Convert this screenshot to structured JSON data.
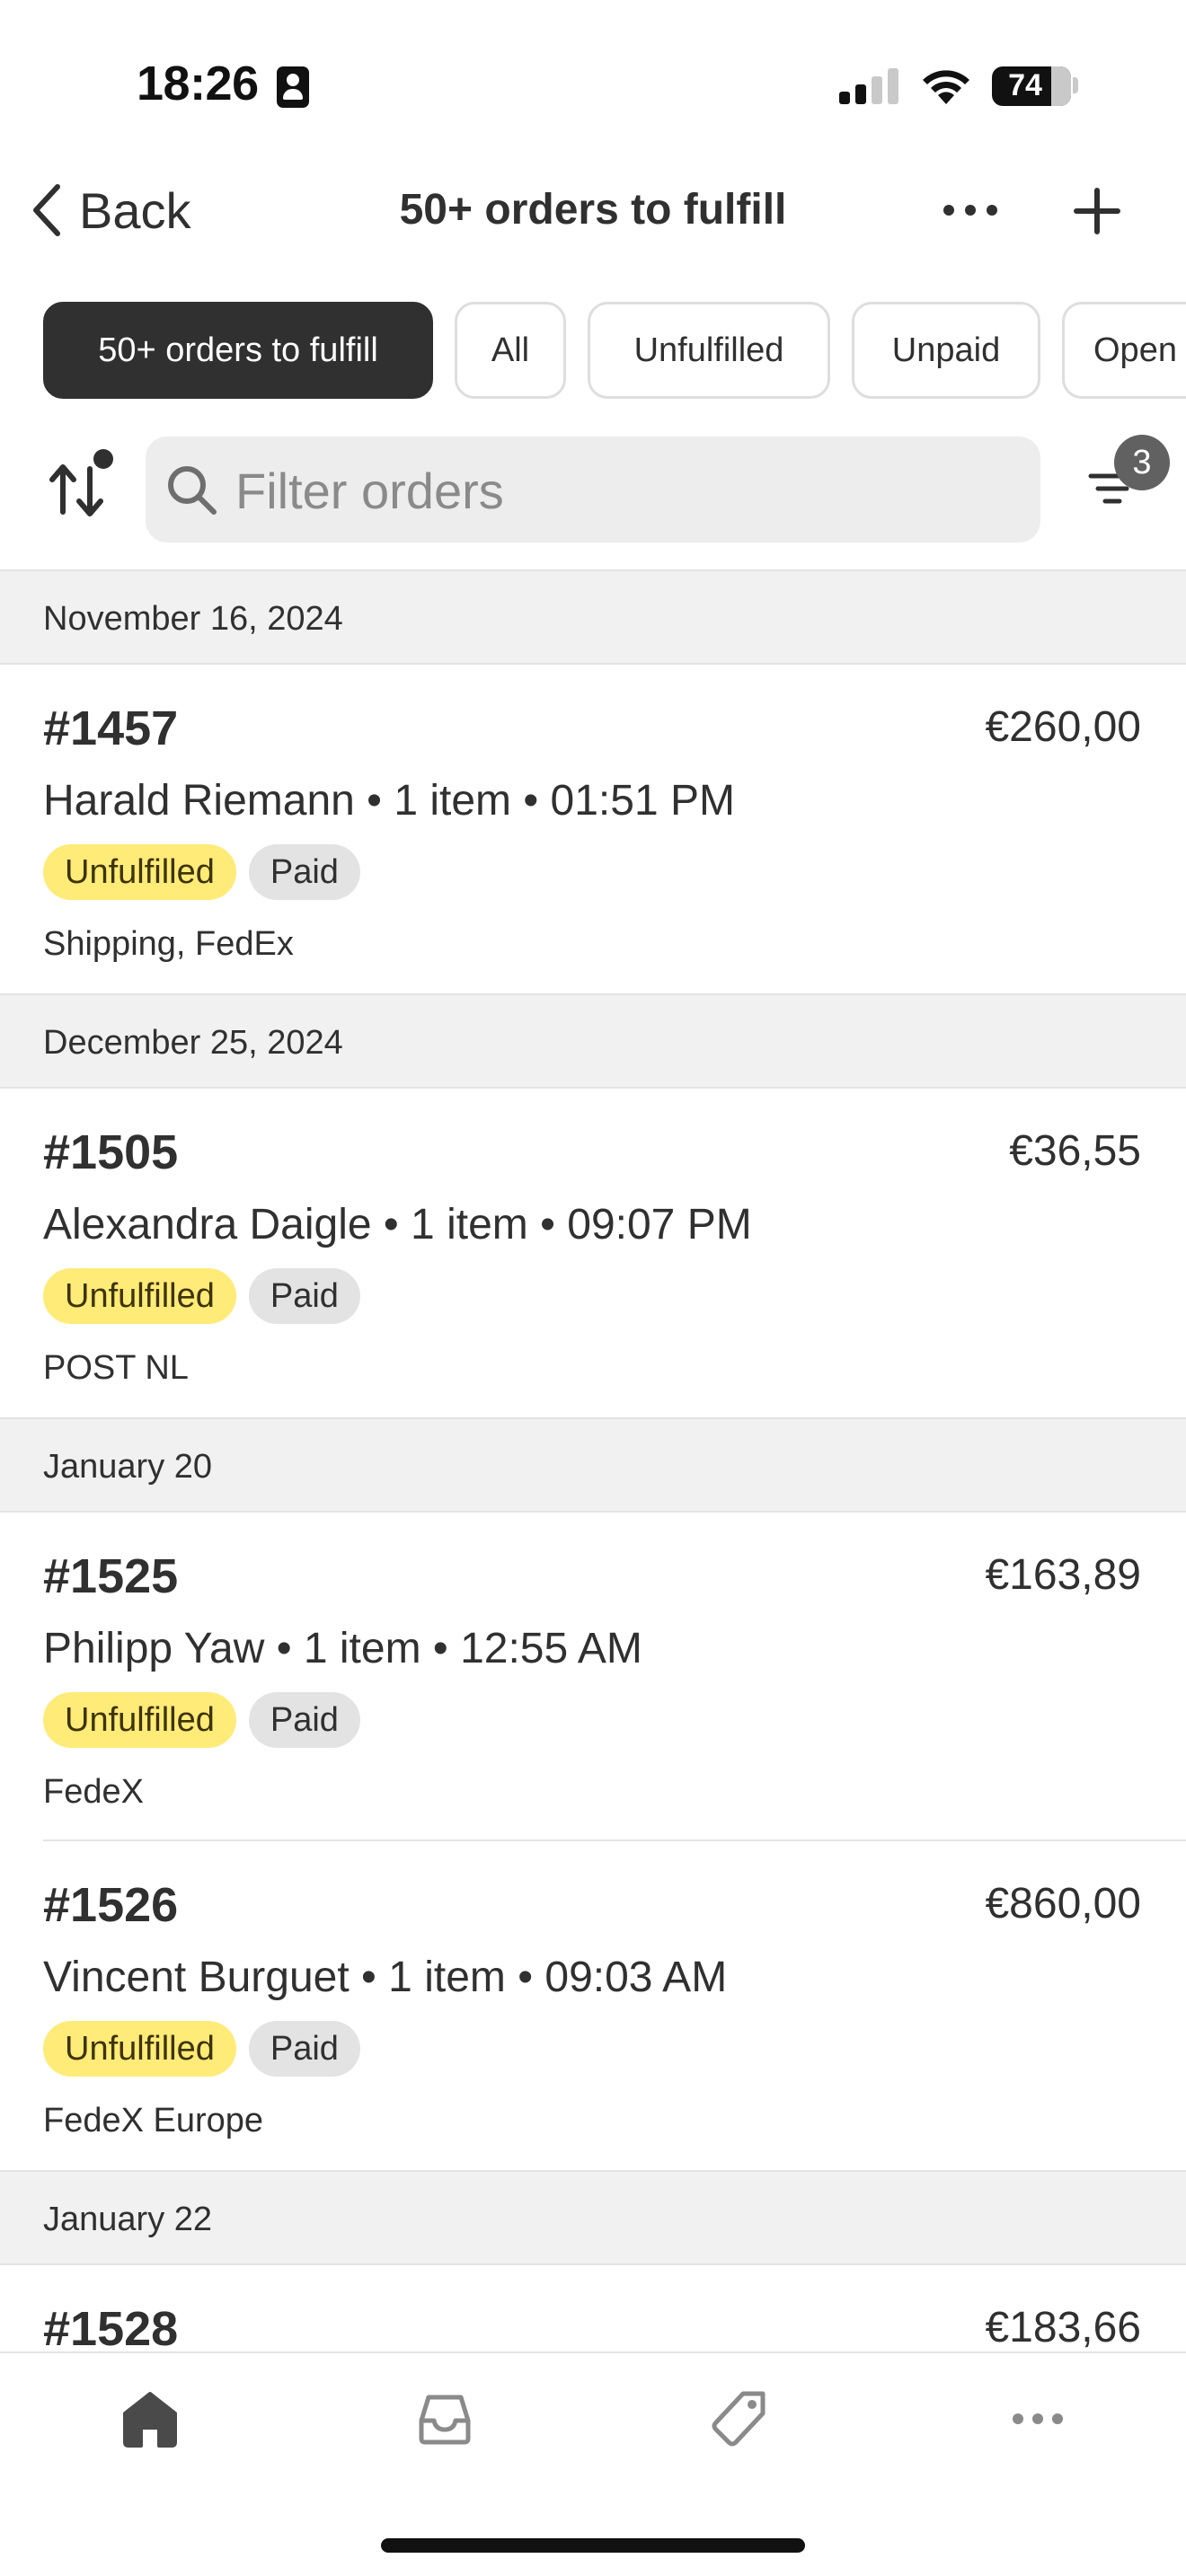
{
  "status_bar": {
    "time": "18:26",
    "battery": "74",
    "icons": [
      "person-badge-icon",
      "signal-icon",
      "wifi-icon",
      "battery-icon"
    ]
  },
  "navbar": {
    "back_label": "Back",
    "title": "50+ orders to fulfill",
    "icons": [
      "chevron-left-icon",
      "more-icon",
      "plus-icon"
    ]
  },
  "chips": [
    {
      "label": "50+ orders to fulfill",
      "active": true
    },
    {
      "label": "All",
      "active": false
    },
    {
      "label": "Unfulfilled",
      "active": false
    },
    {
      "label": "Unpaid",
      "active": false
    },
    {
      "label": "Open",
      "active": false
    }
  ],
  "search": {
    "placeholder": "Filter orders",
    "filter_count": "3",
    "icons": [
      "sort-icon",
      "search-icon",
      "filter-icon"
    ]
  },
  "sections": [
    {
      "date": "November 16, 2024",
      "orders": [
        {
          "number": "#1457",
          "price": "€260,00",
          "customer": "Harald Riemann",
          "items": "1 item",
          "time": "01:51 PM",
          "badges": [
            "Unfulfilled",
            "Paid"
          ],
          "shipping": "Shipping, FedEx"
        }
      ]
    },
    {
      "date": "December 25, 2024",
      "orders": [
        {
          "number": "#1505",
          "price": "€36,55",
          "customer": "Alexandra Daigle",
          "items": "1 item",
          "time": "09:07 PM",
          "badges": [
            "Unfulfilled",
            "Paid"
          ],
          "shipping": "POST NL"
        }
      ]
    },
    {
      "date": "January 20",
      "orders": [
        {
          "number": "#1525",
          "price": "€163,89",
          "customer": "Philipp Yaw",
          "items": "1 item",
          "time": "12:55 AM",
          "badges": [
            "Unfulfilled",
            "Paid"
          ],
          "shipping": "FedeX"
        },
        {
          "number": "#1526",
          "price": "€860,00",
          "customer": "Vincent Burguet",
          "items": "1 item",
          "time": "09:03 AM",
          "badges": [
            "Unfulfilled",
            "Paid"
          ],
          "shipping": "FedeX Europe"
        }
      ]
    },
    {
      "date": "January 22",
      "orders": [
        {
          "number": "#1528",
          "price": "€183,66"
        }
      ]
    }
  ],
  "tabbar": {
    "icons": [
      "home-icon",
      "inbox-icon",
      "tag-icon",
      "more-icon"
    ],
    "active": "home-icon"
  },
  "colors": {
    "text": "#303030",
    "chip_active_bg": "#303030",
    "unfulfilled_badge": "#ffeb78",
    "paid_badge": "#e3e3e3",
    "section_bg": "#f1f1f1"
  }
}
